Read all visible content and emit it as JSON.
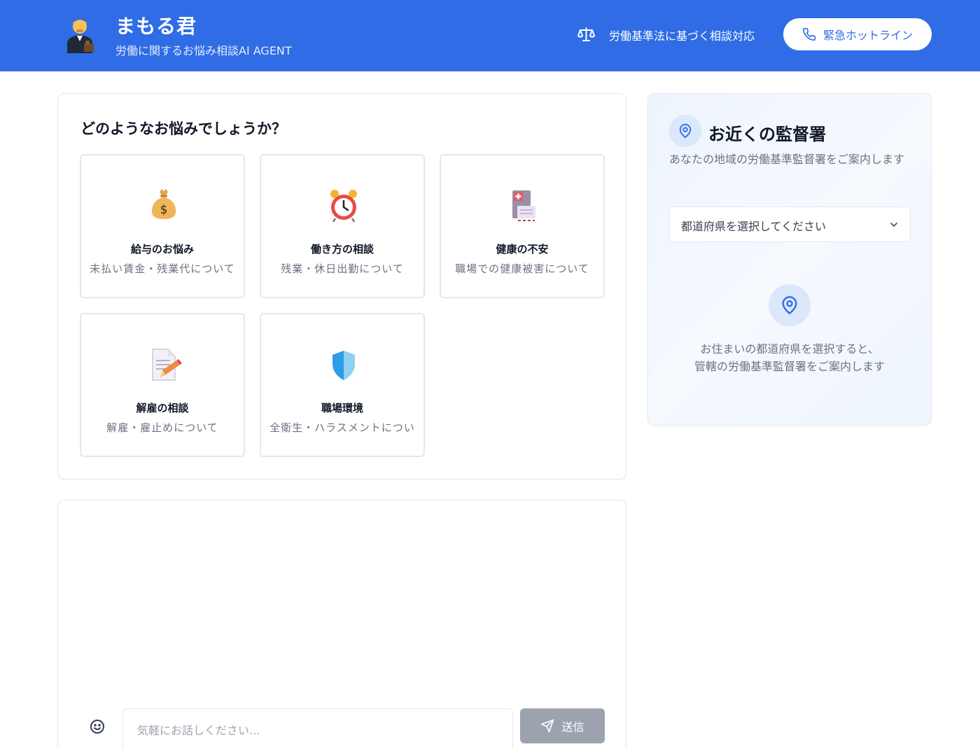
{
  "header": {
    "title": "まもる君",
    "subtitle": "労働に関するお悩み相談AI AGENT",
    "law_note": "労働基準法に基づく相談対応",
    "hotline_label": "緊急ホットライン",
    "logo_icon": "lawyer-avatar-icon",
    "law_icon": "scale-icon",
    "hotline_icon": "phone-icon"
  },
  "topics": {
    "title": "どのようなお悩みでしょうか？",
    "items": [
      {
        "label": "給与のお悩み",
        "desc": "未払い賃金・残業代について",
        "icon": "money-bag-icon"
      },
      {
        "label": "働き方の相談",
        "desc": "残業・休日出勤について",
        "icon": "alarm-clock-icon"
      },
      {
        "label": "健康の不安",
        "desc": "職場での健康被害について",
        "icon": "medical-clipboard-icon"
      },
      {
        "label": "解雇の相談",
        "desc": "解雇・雇止めについて",
        "icon": "document-pencil-icon"
      },
      {
        "label": "職場環境",
        "desc": "全衛生・ハラスメントについ",
        "icon": "shield-icon"
      }
    ]
  },
  "chat": {
    "placeholder": "気軽にお話しください...",
    "send_label": "送信",
    "emoji_icon": "smiley-icon",
    "send_icon": "send-icon"
  },
  "office": {
    "title": "お近くの監督署",
    "description": "あなたの地域の労働基準監督署をご案内します",
    "select_placeholder": "都道府県を選択してください",
    "hint_line1": "お住まいの都道府県を選択すると、",
    "hint_line2": "管轄の労働基準監督署をご案内します",
    "pin_icon": "map-pin-icon"
  },
  "colors": {
    "header_bg": "#2f6ce5",
    "accent": "#2f6ce5",
    "send_disabled": "#9ca3af"
  }
}
